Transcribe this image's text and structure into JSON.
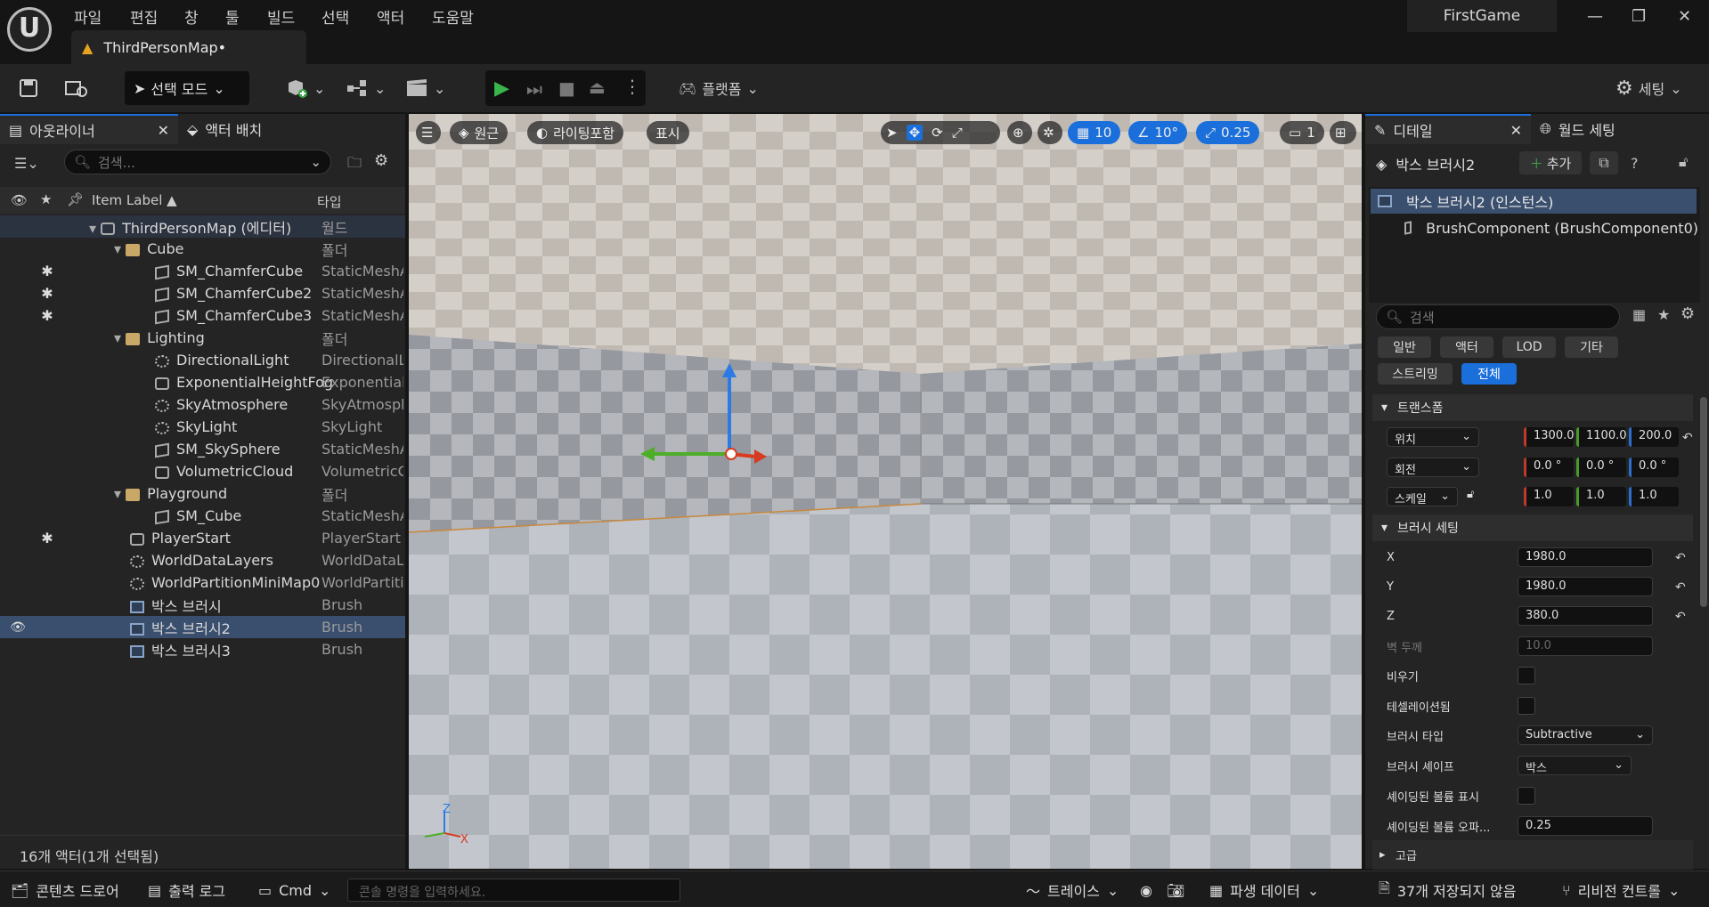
{
  "titlebar": {
    "logo": "U",
    "menus": [
      "파일",
      "편집",
      "창",
      "툴",
      "빌드",
      "선택",
      "액터",
      "도움말"
    ],
    "doc_tab": "ThirdPersonMap•",
    "project": "FirstGame"
  },
  "toolbar": {
    "mode": "선택 모드",
    "platform": "플랫폼",
    "settings": "세팅"
  },
  "outliner": {
    "tab": "아웃라이너",
    "tab2": "액터 배치",
    "search_placeholder": "검색...",
    "col_label": "Item Label ▲",
    "col_type": "타입",
    "footer": "16개 액터(1개 선택됨)",
    "rows": [
      {
        "label": "ThirdPersonMap (에디터)",
        "type": "월드",
        "indent": 3,
        "icon": "gen",
        "expand": true,
        "star": false
      },
      {
        "label": "Cube",
        "type": "폴더",
        "indent": 4,
        "icon": "folder",
        "expand": true,
        "star": false
      },
      {
        "label": "SM_ChamferCube",
        "type": "StaticMeshA",
        "indent": 5,
        "icon": "mesh",
        "star": true
      },
      {
        "label": "SM_ChamferCube2",
        "type": "StaticMeshA",
        "indent": 5,
        "icon": "mesh",
        "star": true
      },
      {
        "label": "SM_ChamferCube3",
        "type": "StaticMeshA",
        "indent": 5,
        "icon": "mesh",
        "star": true
      },
      {
        "label": "Lighting",
        "type": "폴더",
        "indent": 4,
        "icon": "folder",
        "expand": true,
        "star": false
      },
      {
        "label": "DirectionalLight",
        "type": "DirectionalL",
        "indent": 5,
        "icon": "light",
        "star": false
      },
      {
        "label": "ExponentialHeightFog",
        "type": "ExponentialI",
        "indent": 5,
        "icon": "gen",
        "star": false
      },
      {
        "label": "SkyAtmosphere",
        "type": "SkyAtmosph",
        "indent": 5,
        "icon": "light",
        "star": false
      },
      {
        "label": "SkyLight",
        "type": "SkyLight",
        "indent": 5,
        "icon": "light",
        "star": false
      },
      {
        "label": "SM_SkySphere",
        "type": "StaticMeshA",
        "indent": 5,
        "icon": "mesh",
        "star": false
      },
      {
        "label": "VolumetricCloud",
        "type": "VolumetricC",
        "indent": 5,
        "icon": "gen",
        "star": false
      },
      {
        "label": "Playground",
        "type": "폴더",
        "indent": 4,
        "icon": "folder",
        "expand": true,
        "star": false
      },
      {
        "label": "SM_Cube",
        "type": "StaticMeshA",
        "indent": 5,
        "icon": "mesh",
        "star": false
      },
      {
        "label": "PlayerStart",
        "type": "PlayerStart",
        "indent": 4,
        "icon": "gen",
        "star": true
      },
      {
        "label": "WorldDataLayers",
        "type": "WorldDataLa",
        "indent": 4,
        "icon": "light",
        "star": false
      },
      {
        "label": "WorldPartitionMiniMap0",
        "type": "WorldPartiti",
        "indent": 4,
        "icon": "light",
        "star": false
      },
      {
        "label": "박스 브러시",
        "type": "Brush",
        "indent": 4,
        "icon": "brush",
        "star": false
      },
      {
        "label": "박스 브러시2",
        "type": "Brush",
        "indent": 4,
        "icon": "brush",
        "star": false,
        "selected": true
      },
      {
        "label": "박스 브러시3",
        "type": "Brush",
        "indent": 4,
        "icon": "brush",
        "star": false
      }
    ]
  },
  "viewport": {
    "perspective": "원근",
    "lighting": "라이팅포함",
    "show": "표시",
    "grid": "10",
    "angle": "10°",
    "scale": "0.25",
    "camera": "1",
    "axis_z": "Z",
    "axis_x": "X"
  },
  "details": {
    "tab": "디테일",
    "tab2": "월드 세팅",
    "actor_name": "박스 브러시2",
    "add": "추가",
    "instance": "박스 브러시2 (인스턴스)",
    "component": "BrushComponent (BrushComponent0)",
    "search_placeholder": "검색",
    "filters": [
      "일반",
      "액터",
      "LOD",
      "기타",
      "스트리밍",
      "전체"
    ],
    "section_transform": "트랜스폼",
    "location_label": "위치",
    "location": [
      "1300.0",
      "1100.0",
      "200.0"
    ],
    "rotation_label": "회전",
    "rotation": [
      "0.0 °",
      "0.0 °",
      "0.0 °"
    ],
    "scale_label": "스케일",
    "scale": [
      "1.0",
      "1.0",
      "1.0"
    ],
    "section_brush": "브러시 세팅",
    "x_label": "X",
    "x": "1980.0",
    "y_label": "Y",
    "y": "1980.0",
    "z_label": "Z",
    "z": "380.0",
    "wall_label": "벽 두께",
    "wall": "10.0",
    "hollow_label": "비우기",
    "tess_label": "테셀레이션됨",
    "brush_type_label": "브러시 타입",
    "brush_type": "Subtractive",
    "brush_shape_label": "브러시 셰이프",
    "brush_shape": "박스",
    "shaded_label": "셰이딩된 볼륨 표시",
    "opacity_label": "셰이딩된 볼륨 오파...",
    "opacity": "0.25",
    "advanced": "고급"
  },
  "statusbar": {
    "content": "콘텐츠 드로어",
    "output": "출력 로그",
    "cmd": "Cmd",
    "console_placeholder": "콘솔 명령을 입력하세요.",
    "trace": "트레이스",
    "derived": "파생 데이터",
    "unsaved": "37개 저장되지 않음",
    "revision": "리비전 컨트롤"
  }
}
